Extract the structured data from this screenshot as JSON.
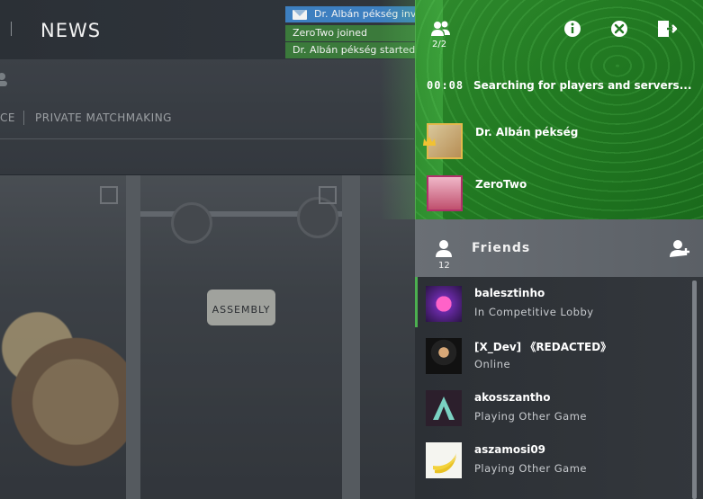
{
  "background": {
    "nav_title": "NEWS",
    "tab_partial": "CE",
    "tab_private": "PRIVATE MATCHMAKING",
    "sign_text": "ASSEMBLY"
  },
  "toasts": [
    {
      "text": "Dr. Albán pékség invi",
      "kind": "invite"
    },
    {
      "text": "ZeroTwo joined",
      "kind": "info"
    },
    {
      "text": "Dr. Albán pékség started r",
      "kind": "info"
    }
  ],
  "party": {
    "count": "2/2",
    "timer": "00:08",
    "status": "Searching for players and servers...",
    "members": [
      {
        "name": "Dr. Albán pékség",
        "leader": true
      },
      {
        "name": "ZeroTwo",
        "leader": false
      }
    ]
  },
  "friends": {
    "title": "Friends",
    "count": "12",
    "list": [
      {
        "name": "balesztinho",
        "status": "In Competitive Lobby"
      },
      {
        "name": "[X_Dev] 《REDACTED》",
        "status": "Online"
      },
      {
        "name": "akosszantho",
        "status": "Playing Other Game"
      },
      {
        "name": "aszamosi09",
        "status": "Playing Other Game"
      }
    ]
  },
  "colors": {
    "party_green": "#227a22",
    "invite_blue": "#3d7fc0",
    "toast_green": "#3b7a3b",
    "online_accent": "#4caf50"
  },
  "icons": [
    "party-icon",
    "info-icon",
    "close-circle-icon",
    "exit-icon",
    "person-icon",
    "add-friend-icon",
    "mail-icon",
    "crown-icon"
  ]
}
